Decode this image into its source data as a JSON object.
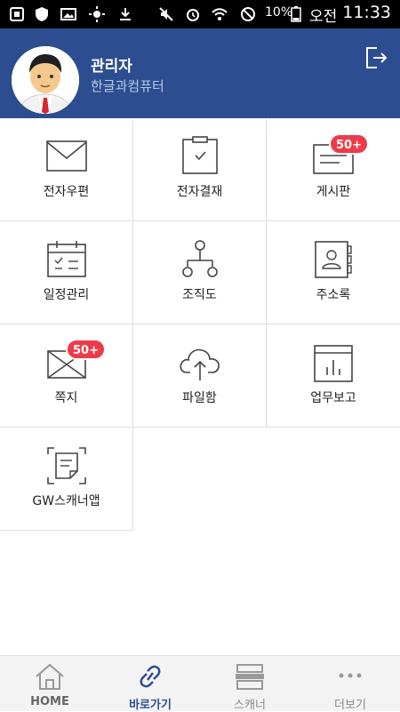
{
  "status_bar": {
    "battery_percent": "10%",
    "ampm": "오전",
    "time": "11:33"
  },
  "profile": {
    "name": "관리자",
    "organization": "한글과컴퓨터"
  },
  "menu": {
    "mail": {
      "label": "전자우편"
    },
    "approval": {
      "label": "전자결재"
    },
    "board": {
      "label": "게시판",
      "badge": "50+"
    },
    "schedule": {
      "label": "일정관리"
    },
    "org_chart": {
      "label": "조직도"
    },
    "address_book": {
      "label": "주소록"
    },
    "notes": {
      "label": "쪽지",
      "badge": "50+"
    },
    "file_box": {
      "label": "파일함"
    },
    "work_report": {
      "label": "업무보고"
    },
    "scanner_app": {
      "label": "GW스캐너앱"
    }
  },
  "bottom_nav": {
    "home": "HOME",
    "shortcuts": "바로가기",
    "scanner": "스캐너",
    "more": "더보기",
    "active": "shortcuts"
  },
  "colors": {
    "header_bg": "#2c4d8f",
    "badge": "#ee3b4a",
    "active_nav": "#2c4d8f"
  }
}
